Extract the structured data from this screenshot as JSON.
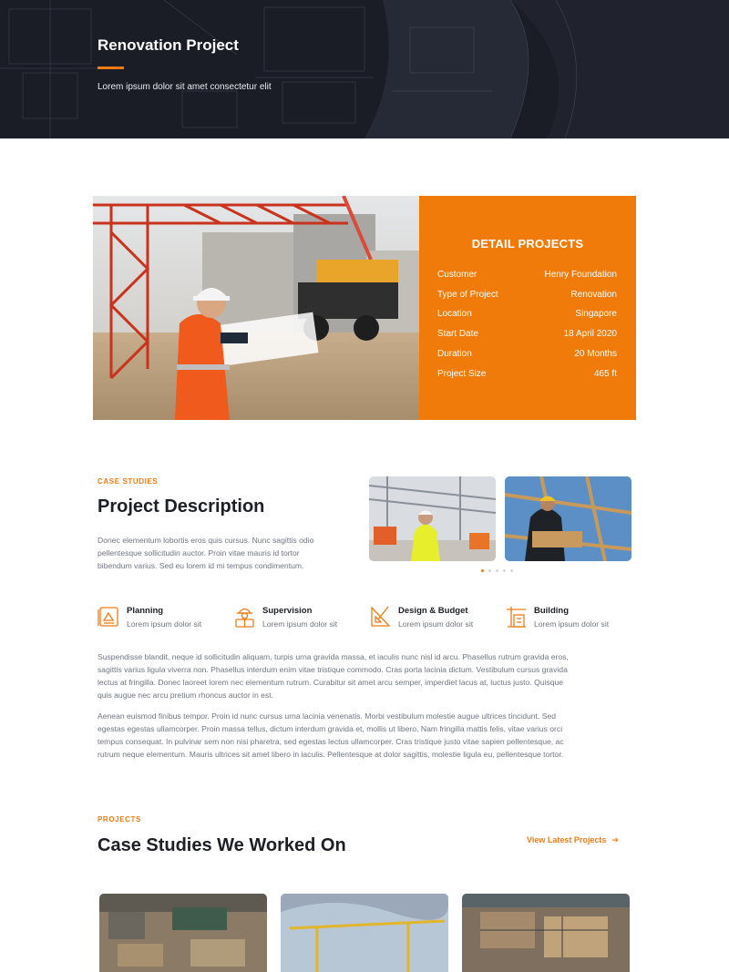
{
  "hero": {
    "title": "Renovation Project",
    "subtitle": "Lorem ipsum dolor sit amet consectetur elit"
  },
  "details": {
    "title": "DETAIL PROJECTS",
    "rows": [
      {
        "label": "Customer",
        "value": "Henry Foundation"
      },
      {
        "label": "Type of Project",
        "value": "Renovation"
      },
      {
        "label": "Location",
        "value": "Singapore"
      },
      {
        "label": "Start Date",
        "value": "18 April 2020"
      },
      {
        "label": "Duration",
        "value": "20 Months"
      },
      {
        "label": "Project Size",
        "value": "465 ft"
      }
    ]
  },
  "case_studies": {
    "eyebrow": "CASE STUDIES",
    "title": "Project Description",
    "intro_lines": [
      "Donec elementum lobortis eros quis cursus. Nunc sagittis odio",
      "pellentesque sollicitudin auctor. Proin vitae mauris id tortor",
      "bibendum varius. Sed eu lorem id mi tempus condimentum."
    ],
    "slider": {
      "dot_count": 5,
      "active_index": 0
    },
    "features": [
      {
        "title": "Planning",
        "subtitle": "Lorem ipsum dolor sit",
        "icon": "blueprint-icon"
      },
      {
        "title": "Supervision",
        "subtitle": "Lorem ipsum dolor sit",
        "icon": "engineer-icon"
      },
      {
        "title": "Design & Budget",
        "subtitle": "Lorem ipsum dolor sit",
        "icon": "drafting-tools-icon"
      },
      {
        "title": "Building",
        "subtitle": "Lorem ipsum dolor sit",
        "icon": "building-icon"
      }
    ],
    "body1_lines": [
      "Suspendisse blandit, neque id sollicitudin aliquam, turpis urna gravida massa, et iaculis nunc nisl id arcu. Phasellus rutrum gravida eros,",
      "sagittis varius ligula viverra non. Phasellus interdum enim vitae tristique commodo. Cras porta lacinia dictum. Vestibulum cursus gravida",
      "lectus at fringilla. Donec laoreet lorem nec elementum rutrum. Curabitur sit amet arcu semper, imperdiet lacus at, luctus justo. Quisque",
      "quis augue nec arcu pretium rhoncus auctor in est."
    ],
    "body2_lines": [
      "Aenean euismod finibus tempor. Proin id nunc cursus urna lacinia venenatis. Morbi vestibulum molestie augue ultrices tincidunt. Sed",
      "egestas egestas ullamcorper. Proin massa tellus, dictum interdum gravida et, mollis ut libero. Nam fringilla mattis felis, vitae varius orci",
      "tempus consequat. In pulvinar sem non nisi pharetra, sed egestas lectus ullamcorper. Cras tristique justo vitae sapien pellentesque, ac",
      "rutrum neque elementum. Mauris ultrices sit amet libero in iaculis. Pellentesque at dolor sagittis, molestie ligula eu, pellentesque tortor."
    ]
  },
  "projects": {
    "eyebrow": "PROJECTS",
    "title": "Case Studies We Worked On",
    "link_label": "View Latest Projects",
    "link_icon": "arrow-right-icon"
  },
  "colors": {
    "accent": "#f07b13",
    "dark": "#1a1d26",
    "text": "#1c1f26",
    "muted": "#6f7480"
  }
}
